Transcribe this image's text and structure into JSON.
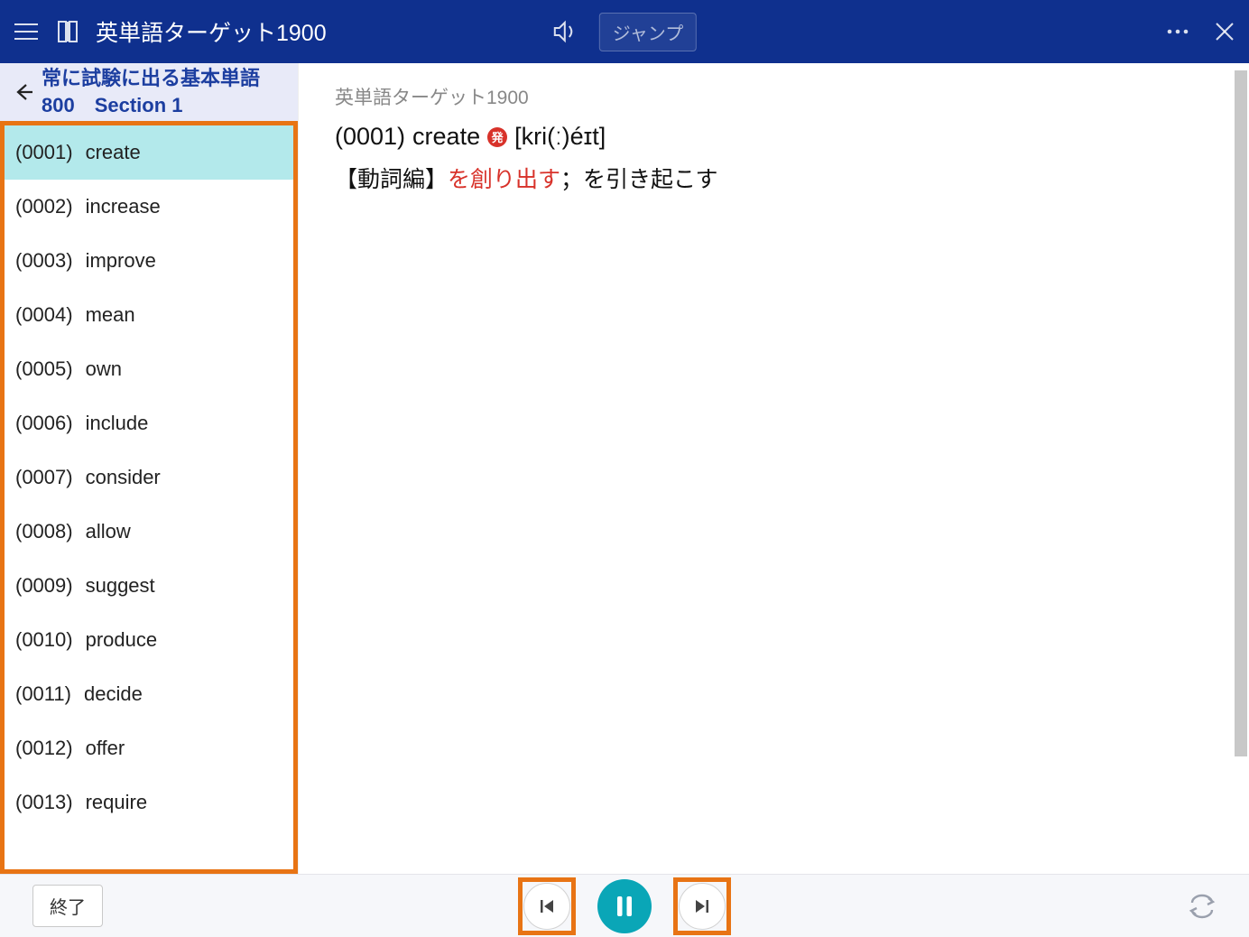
{
  "header": {
    "title": "英単語ターゲット1900",
    "jump_label": "ジャンプ"
  },
  "sidebar": {
    "subtitle_line1": "常に試験に出る基本単語",
    "subtitle_line2": "800　Section 1",
    "items": [
      {
        "num": "(0001)",
        "word": "create",
        "selected": true
      },
      {
        "num": "(0002)",
        "word": "increase"
      },
      {
        "num": "(0003)",
        "word": "improve"
      },
      {
        "num": "(0004)",
        "word": "mean"
      },
      {
        "num": "(0005)",
        "word": "own"
      },
      {
        "num": "(0006)",
        "word": "include"
      },
      {
        "num": "(0007)",
        "word": "consider"
      },
      {
        "num": "(0008)",
        "word": "allow"
      },
      {
        "num": "(0009)",
        "word": "suggest"
      },
      {
        "num": "(0010)",
        "word": "produce"
      },
      {
        "num": "(0011)",
        "word": "decide"
      },
      {
        "num": "(0012)",
        "word": "offer"
      },
      {
        "num": "(0013)",
        "word": "require"
      }
    ]
  },
  "main": {
    "book_title": "英単語ターゲット1900",
    "entry_number": "(0001)",
    "entry_word": "create",
    "pron_badge": "発",
    "pronunciation": "[kri(ː)éɪt]",
    "definition_bracket": "【動詞編】",
    "definition_accent": "を創り出す",
    "definition_rest": "；を引き起こす"
  },
  "footer": {
    "end_label": "終了"
  },
  "colors": {
    "header_bg": "#0f308e",
    "highlight_orange": "#e87414",
    "selected_bg": "#b3e9eb",
    "pause_bg": "#0aa6b7",
    "accent_red": "#d8322a"
  }
}
